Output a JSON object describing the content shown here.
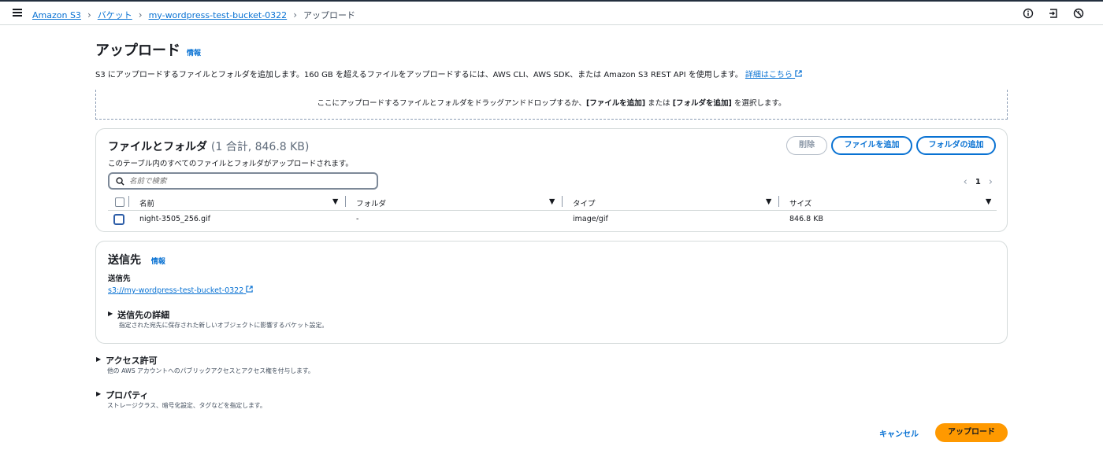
{
  "breadcrumb": {
    "items": [
      "Amazon S3",
      "バケット",
      "my-wordpress-test-bucket-0322"
    ],
    "current": "アップロード"
  },
  "page": {
    "title": "アップロード",
    "info_label": "情報",
    "description": "S3 にアップロードするファイルとフォルダを追加します。160 GB を超えるファイルをアップロードするには、AWS CLI、AWS SDK、または Amazon S3 REST API を使用します。",
    "learn_more": "詳細はこちら"
  },
  "dropzone": {
    "prefix": "ここにアップロードするファイルとフォルダをドラッグアンドドロップするか、",
    "add_files": "[ファイルを追加]",
    "middle": " または ",
    "add_folder": "[フォルダを追加]",
    "suffix": " を選択します。"
  },
  "files_panel": {
    "title": "ファイルとフォルダ",
    "count": "(1 合計, 846.8 KB)",
    "subtitle": "このテーブル内のすべてのファイルとフォルダがアップロードされます。",
    "delete_button": "削除",
    "add_files_button": "ファイルを追加",
    "add_folder_button": "フォルダの追加",
    "search_placeholder": "名前で検索",
    "page_number": "1",
    "columns": [
      "名前",
      "フォルダ",
      "タイプ",
      "サイズ"
    ],
    "rows": [
      {
        "name": "night-3505_256.gif",
        "folder": "-",
        "type": "image/gif",
        "size": "846.8 KB"
      }
    ]
  },
  "destination": {
    "title": "送信先",
    "info_label": "情報",
    "label": "送信先",
    "path": "s3://my-wordpress-test-bucket-0322",
    "details_title": "送信先の詳細",
    "details_desc": "指定された宛先に保存された新しいオブジェクトに影響するバケット設定。"
  },
  "permissions": {
    "title": "アクセス許可",
    "desc": "他の AWS アカウントへのパブリックアクセスとアクセス権を付与します。"
  },
  "properties": {
    "title": "プロパティ",
    "desc": "ストレージクラス、暗号化設定、タグなどを指定します。"
  },
  "footer": {
    "cancel": "キャンセル",
    "upload": "アップロード"
  },
  "colors": {
    "link": "#0972d3",
    "primary_button": "#ff9900",
    "border": "#d5dbdb"
  },
  "icons": [
    "menu-icon",
    "info-circle-icon",
    "exit-icon",
    "clock-icon",
    "external-link-icon",
    "search-icon"
  ]
}
